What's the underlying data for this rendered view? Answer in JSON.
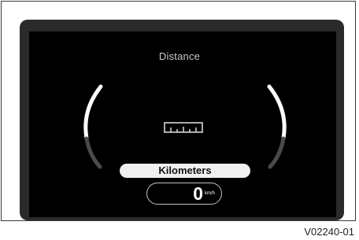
{
  "display": {
    "title": "Distance",
    "unit_label": "Kilometers",
    "speed_value": "0",
    "speed_unit": "km/h",
    "icon": "ruler-icon"
  },
  "caption": "V02240-01",
  "colors": {
    "background": "#ffffff",
    "bezel": "#2a2a2a",
    "screen": "#000000",
    "gauge_active": "#ffffff",
    "gauge_inactive": "#4a4a4a",
    "text_light": "#c8c8c8",
    "pill": "#f0f0f0"
  }
}
